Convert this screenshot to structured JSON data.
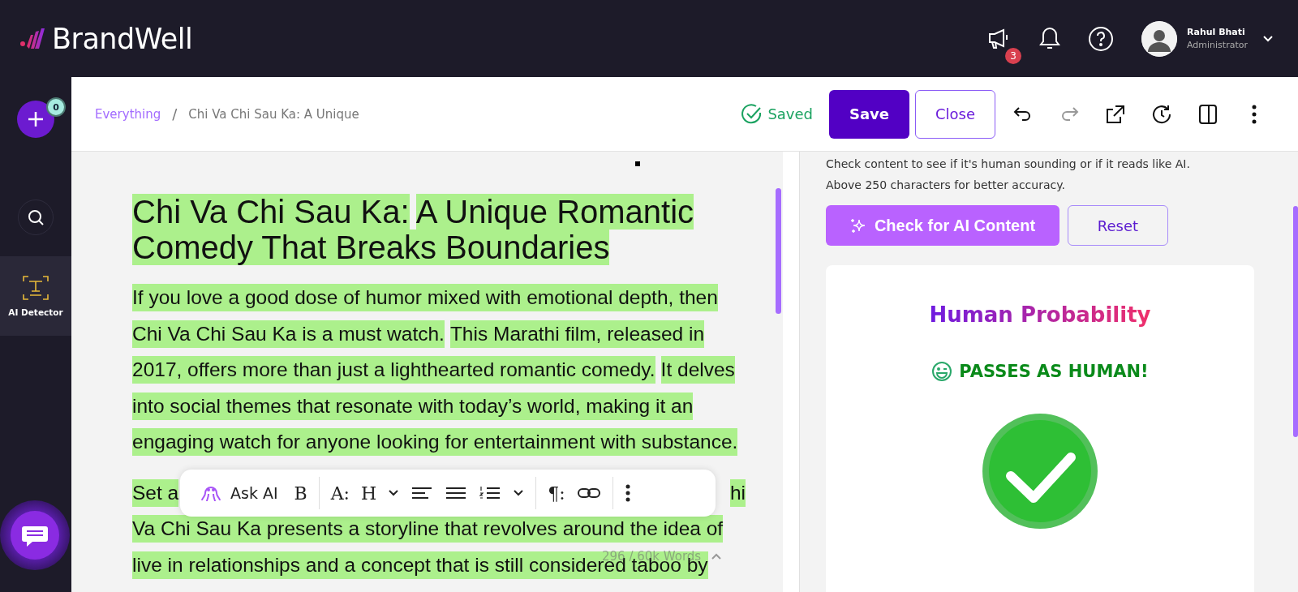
{
  "topbar": {
    "logo": "BrandWell",
    "announcements_badge": "3",
    "user": {
      "name": "Rahul Bhati",
      "role": "Administrator"
    }
  },
  "sidebar": {
    "new_badge": "0",
    "items": [
      {
        "label": "AI Detector",
        "selected": true
      }
    ]
  },
  "header": {
    "breadcrumb": [
      "Everything",
      "/",
      "Chi Va Chi Sau Ka: A Unique"
    ],
    "status": "Saved",
    "save": "Save",
    "close": "Close",
    "tools": [
      {
        "kind": "undo",
        "disabled": false
      },
      {
        "kind": "redo",
        "disabled": true
      },
      {
        "kind": "export",
        "disabled": false
      },
      {
        "kind": "history",
        "disabled": false
      },
      {
        "kind": "panel",
        "disabled": false
      },
      {
        "kind": "more",
        "disabled": false
      }
    ]
  },
  "editor": {
    "title_lines": [
      [
        "Chi Va Chi Sau Ka:",
        "A Unique Romantic"
      ],
      [
        "Comedy That Breaks Boundaries"
      ]
    ],
    "paragraphs": [
      [
        {
          "segments": [
            "If you love a good dose of humor mixed with emotional depth, then"
          ],
          "occluded": false
        },
        {
          "segments": [
            "Chi Va Chi Sau Ka is a must watch.",
            "This Marathi film, released in"
          ],
          "occluded": false
        },
        {
          "segments": [
            "2017, offers more than just a lighthearted romantic comedy.",
            "It delves"
          ],
          "occluded": false
        },
        {
          "segments": [
            "into social themes that resonate with today’s world, making it an"
          ],
          "occluded": false
        },
        {
          "segments": [
            "engaging watch for anyone looking for entertainment with substance."
          ],
          "occluded": false
        }
      ],
      [
        {
          "segments": [
            "Set a",
            "hi"
          ],
          "occluded": true
        },
        {
          "segments": [
            "Va Chi Sau Ka presents a storyline that revolves around the idea of"
          ],
          "occluded": false
        },
        {
          "segments": [
            "live in relationships and a concept that is still considered taboo by"
          ],
          "occluded": false
        }
      ]
    ],
    "toolbar": {
      "items": [
        {
          "kind": "ai",
          "label": "Ask AI"
        },
        {
          "kind": "text",
          "label": "B"
        },
        {
          "kind": "divider"
        },
        {
          "kind": "text",
          "label": "A:"
        },
        {
          "kind": "text",
          "label": "H"
        },
        {
          "kind": "chevron"
        },
        {
          "kind": "align"
        },
        {
          "kind": "justify"
        },
        {
          "kind": "numbered"
        },
        {
          "kind": "chevron"
        },
        {
          "kind": "divider"
        },
        {
          "kind": "text",
          "label": "¶:"
        },
        {
          "kind": "link"
        },
        {
          "kind": "divider"
        },
        {
          "kind": "more"
        }
      ]
    },
    "word_count": "296 / 60k Words"
  },
  "panel": {
    "hint_lines": [
      "Check content to see if it's human sounding or if it reads like AI.",
      "Above 250 characters for better accuracy."
    ],
    "check_button": "Check for AI Content",
    "reset_button": "Reset",
    "result": {
      "title": "Human Probability",
      "verdict": "PASSES AS HUMAN!",
      "passed": true
    }
  }
}
